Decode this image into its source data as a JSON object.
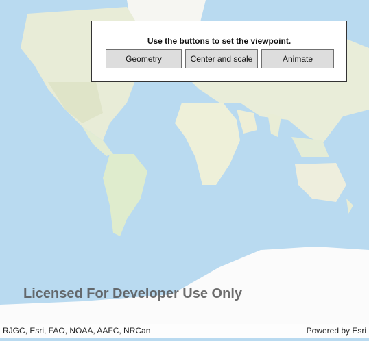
{
  "panel": {
    "instruction": "Use the buttons to set the viewpoint.",
    "buttons": {
      "geometry": "Geometry",
      "center_scale": "Center and scale",
      "animate": "Animate"
    }
  },
  "map": {
    "watermark": "Licensed For Developer Use Only",
    "attribution": "RJGC, Esri, FAO, NOAA, AAFC, NRCan",
    "powered_by": "Powered by Esri",
    "colors": {
      "ocean": "#b9daf0",
      "land": "#eef0df",
      "ice": "#fbfbfb"
    }
  }
}
